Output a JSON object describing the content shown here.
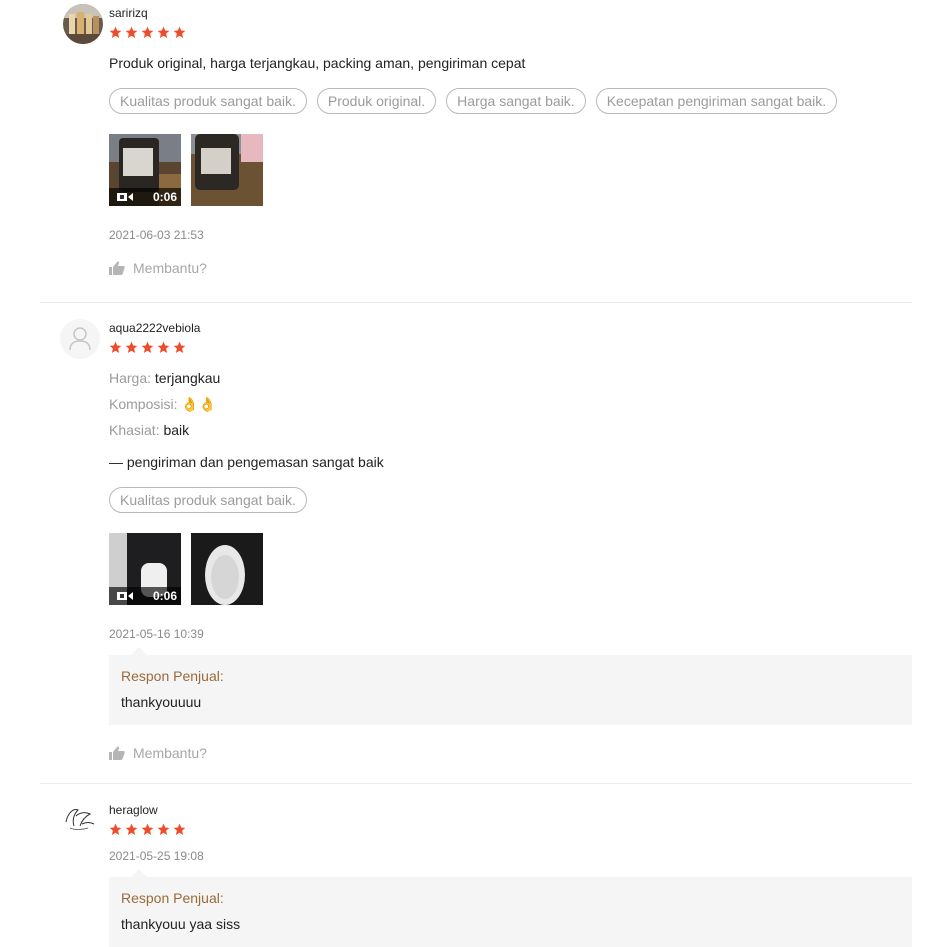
{
  "reviews": [
    {
      "username": "saririzq",
      "rating": 5,
      "comment": "Produk original, harga terjangkau, packing aman, pengiriman cepat",
      "tags": [
        "Kualitas produk sangat baik.",
        "Produk original.",
        "Harga sangat baik.",
        "Kecepatan pengiriman sangat baik."
      ],
      "video_duration": "0:06",
      "timestamp": "2021-06-03 21:53",
      "helpful_label": "Membantu?"
    },
    {
      "username": "aqua2222vebiola",
      "rating": 5,
      "attributes": [
        {
          "key": "Harga:",
          "value": "terjangkau"
        },
        {
          "key": "Komposisi:",
          "value": "👌👌"
        },
        {
          "key": "Khasiat:",
          "value": "baik"
        }
      ],
      "comment": "— pengiriman dan pengemasan sangat baik",
      "tags": [
        "Kualitas produk sangat baik."
      ],
      "video_duration": "0:06",
      "timestamp": "2021-05-16 10:39",
      "response_title": "Respon Penjual:",
      "response_text": "thankyouuuu",
      "helpful_label": "Membantu?"
    },
    {
      "username": "heraglow",
      "rating": 5,
      "timestamp": "2021-05-25 19:08",
      "response_title": "Respon Penjual:",
      "response_text": "thankyouu yaa siss"
    }
  ],
  "colors": {
    "star": "#ee4d2d",
    "response_title": "#9a6a3a",
    "tag_border": "#b9b9b9"
  }
}
